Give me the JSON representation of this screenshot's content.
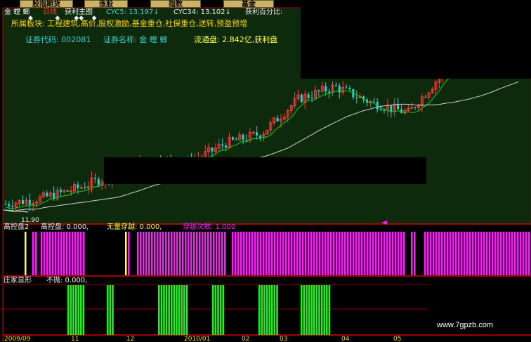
{
  "tabs": [
    "股指期货",
    "涨股",
    "指数",
    "基金"
  ],
  "header": {
    "stock_name": "金 螳 螂",
    "period": "日线",
    "main_chart": "获利主图",
    "cyc5": "CYC5: 13.197↓",
    "cyc34": "CYC34: 13.102↓",
    "profit_pct": "获利百分比:"
  },
  "sector_line": "所属板块: 工程建筑,高价,股权激励,基金重仓,社保重仓,送转,预盈预增",
  "info_line": {
    "code_label": "证券代码: 002081",
    "name_label": "证券名称: 金 螳 螂",
    "float_label": "流通盘: 2.842亿,获利盘"
  },
  "price_label": "11.90",
  "panel2": {
    "title": "高控盘2",
    "a_label": "高控盘: 0.000,",
    "b_label": "无量穿越: 0.000,",
    "c_label": "穿越次数: 1.000"
  },
  "panel3": {
    "title": "庄家显形",
    "a_label": "不抛: 0.000,"
  },
  "date_labels": [
    "2009/09",
    "11",
    "12",
    "2010/01",
    "02",
    "03",
    "04",
    "05"
  ],
  "watermark": "www.7gpzb.com",
  "colors": {
    "up": "#ff3b3b",
    "down": "#2fd0d0",
    "ma_short": "#10d010",
    "ma_long": "#d0d0d0",
    "magenta": "#ff1aff",
    "green": "#22ee22",
    "yellow": "#ffff44",
    "frame": "#a00000"
  },
  "chart_data": [
    {
      "type": "candlestick",
      "title": "金 螳 螂 日线",
      "series": [
        {
          "name": "CYC5",
          "value": 13.197
        },
        {
          "name": "CYC34",
          "value": 13.102
        }
      ],
      "low_marker": 11.9,
      "trend_closes": [
        12.0,
        12.3,
        12.8,
        13.5,
        14.2,
        14.0,
        15.0,
        15.5,
        17.2,
        17.8,
        17.0,
        16.5,
        18.6,
        18.9,
        19.1
      ]
    },
    {
      "type": "bar",
      "title": "高控盘2",
      "series": [
        {
          "name": "高控盘",
          "value": 0.0
        },
        {
          "name": "无量穿越",
          "value": 0.0
        },
        {
          "name": "穿越次数",
          "value": 1.0
        }
      ]
    },
    {
      "type": "bar",
      "title": "庄家显形",
      "series": [
        {
          "name": "不抛",
          "value": 0.0
        }
      ]
    }
  ]
}
